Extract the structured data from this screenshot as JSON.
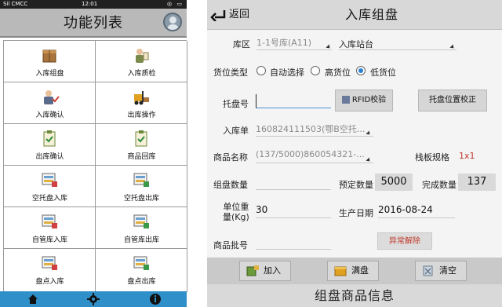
{
  "phone": {
    "status": {
      "carrier": "Sil CMCC",
      "time": "12:01",
      "icons": "◎ ▭"
    },
    "title": "功能列表",
    "avatar_label": "",
    "tiles": [
      {
        "label": "入库组盘",
        "icon": "box-icon"
      },
      {
        "label": "入库质检",
        "icon": "inspector-icon"
      },
      {
        "label": "入库确认",
        "icon": "person-check-icon"
      },
      {
        "label": "出库操作",
        "icon": "forklift-icon"
      },
      {
        "label": "出库确认",
        "icon": "clipboard-check-icon"
      },
      {
        "label": "商品回库",
        "icon": "clipboard-check-icon"
      },
      {
        "label": "空托盘入库",
        "icon": "pallet-icon"
      },
      {
        "label": "空托盘出库",
        "icon": "pallet-icon"
      },
      {
        "label": "自管库入库",
        "icon": "pallet-icon"
      },
      {
        "label": "自管库出库",
        "icon": "pallet-icon"
      },
      {
        "label": "盘点入库",
        "icon": "pallet-icon"
      },
      {
        "label": "盘点出库",
        "icon": "pallet-icon"
      }
    ],
    "bottom_nav": [
      "home-icon",
      "gear-icon",
      "info-icon"
    ]
  },
  "tablet": {
    "back_label": "返回",
    "title": "入库组盘",
    "area_label": "库区",
    "area_value": "1-1号库(A11)",
    "station_label": "入库站台",
    "slot_type_label": "货位类型",
    "slot_options": [
      "自动选择",
      "高货位",
      "低货位"
    ],
    "slot_selected": "低货位",
    "tray_label": "托盘号",
    "tray_value": "",
    "rfid_button": "RFID校验",
    "tray_pos_button": "托盘位置校正",
    "order_label": "入库单",
    "order_value": "160824111503(鄂B空托...",
    "product_label": "商品名称",
    "product_value": "(137/5000)860054321-...",
    "spec_label": "栈板规格",
    "spec_value": "1x1",
    "group_qty_label": "组盘数量",
    "group_qty_value": "",
    "planned_label": "预定数量",
    "planned_value": "5000",
    "done_label": "完成数量",
    "done_value": "137",
    "unit_weight_label": "单位重\n量(Kg)",
    "unit_weight_value": "30",
    "prod_date_label": "生产日期",
    "prod_date_value": "2016-08-24",
    "batch_label": "商品批号",
    "batch_value": "",
    "exception_button": "异常解除",
    "actions": [
      {
        "label": "加入",
        "icon": "add-box-icon"
      },
      {
        "label": "满盘",
        "icon": "full-pallet-icon"
      },
      {
        "label": "清空",
        "icon": "clear-icon"
      }
    ],
    "footer": "组盘商品信息"
  }
}
